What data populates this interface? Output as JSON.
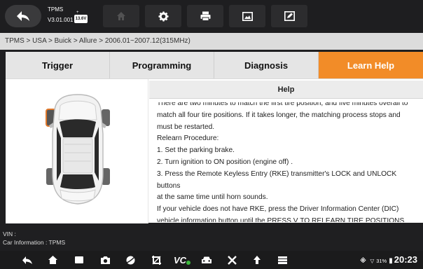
{
  "app": {
    "name": "TPMS",
    "version": "V3.01.001",
    "battery_voltage": "13.6V"
  },
  "breadcrumb": "TPMS > USA > Buick > Allure > 2006.01~2007.12(315MHz)",
  "tabs": [
    {
      "label": "Trigger",
      "active": false
    },
    {
      "label": "Programming",
      "active": false
    },
    {
      "label": "Diagnosis",
      "active": false
    },
    {
      "label": "Learn Help",
      "active": true
    }
  ],
  "help": {
    "title": "Help",
    "lines": [
      "There are two minutes to match the first tire position, and five minutes overall to",
      "match all four tire positions. If it takes longer, the matching process stops and",
      "must be restarted.",
      "Relearn Procedure:",
      "1. Set the parking brake.",
      "2. Turn ignition to ON position (engine off) .",
      "3. Press the Remote Keyless Entry (RKE) transmitter's LOCK and UNLOCK buttons",
      "at the same time until horn sounds.",
      "If your vehicle does not have RKE, press the Driver Information Center (DIC)",
      "vehicle information button until the PRESS V TO RELEARN TIRE POSITIONS"
    ]
  },
  "vehicle_info": {
    "vin_label": "VIN :",
    "car_information": "Car Information : TPMS"
  },
  "status_bar": {
    "battery_percent": "31%",
    "time": "20:23"
  },
  "colors": {
    "accent": "#f28c28",
    "selected_tire": "#e0782a"
  }
}
